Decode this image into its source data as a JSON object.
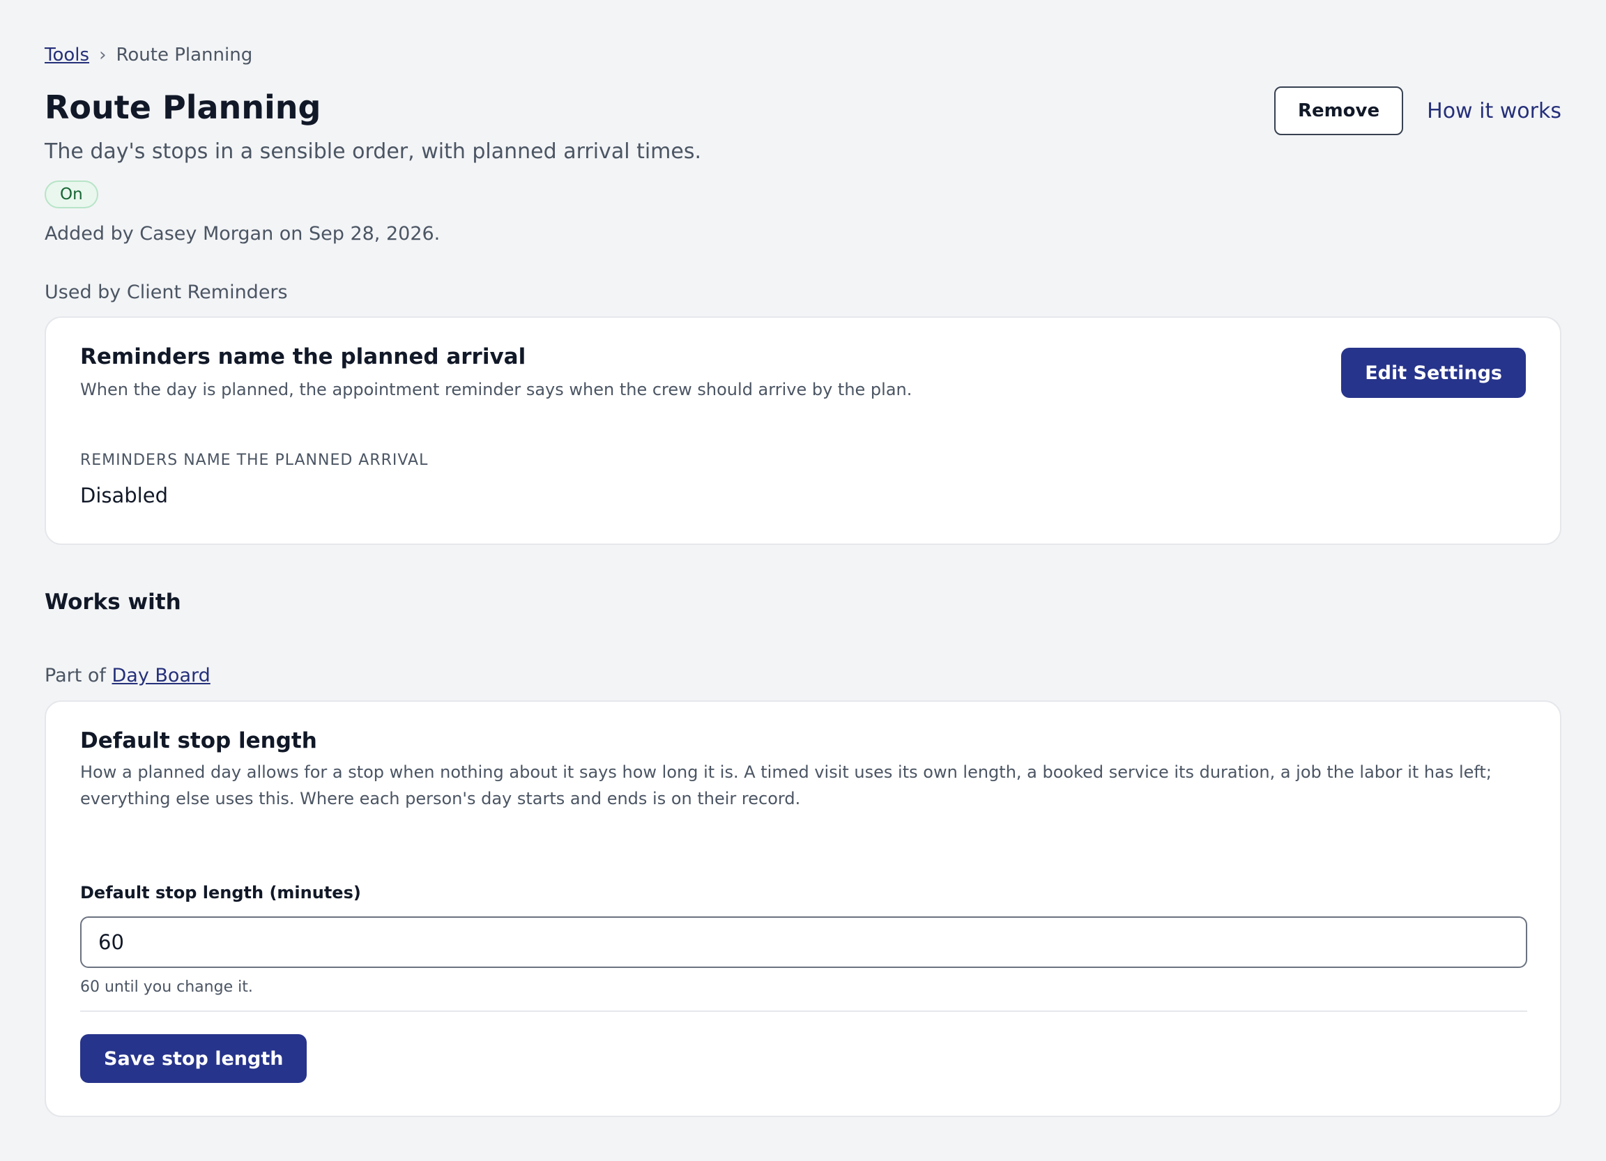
{
  "breadcrumb": {
    "parent_label": "Tools",
    "separator": "›",
    "current_label": "Route Planning"
  },
  "header": {
    "title": "Route Planning",
    "subtitle": "The day's stops in a sensible order, with planned arrival times.",
    "status": "On",
    "added_by": "Added by Casey Morgan on Sep 28, 2026.",
    "remove_label": "Remove",
    "how_it_works_label": "How it works"
  },
  "used_by": {
    "caption": "Used by Client Reminders",
    "card": {
      "title": "Reminders name the planned arrival",
      "description": "When the day is planned, the appointment reminder says when the crew should arrive by the plan.",
      "edit_label": "Edit Settings",
      "field_label": "Reminders name the planned arrival",
      "field_value": "Disabled"
    }
  },
  "works_with": {
    "heading": "Works with",
    "part_of_prefix": "Part of",
    "part_of_link": "Day Board",
    "card": {
      "title": "Default stop length",
      "description": "How a planned day allows for a stop when nothing about it says how long it is. A timed visit uses its own length, a booked service its duration, a job the labor it has left; everything else uses this. Where each person's day starts and ends is on their record.",
      "input_label": "Default stop length (minutes)",
      "input_value": "60",
      "help_text": "60 until you change it.",
      "save_label": "Save stop length"
    }
  },
  "colors": {
    "primary": "#27348b",
    "link": "#25307a",
    "status_bg": "#e9f7ee",
    "status_text": "#166534",
    "page_bg": "#f3f4f6"
  }
}
